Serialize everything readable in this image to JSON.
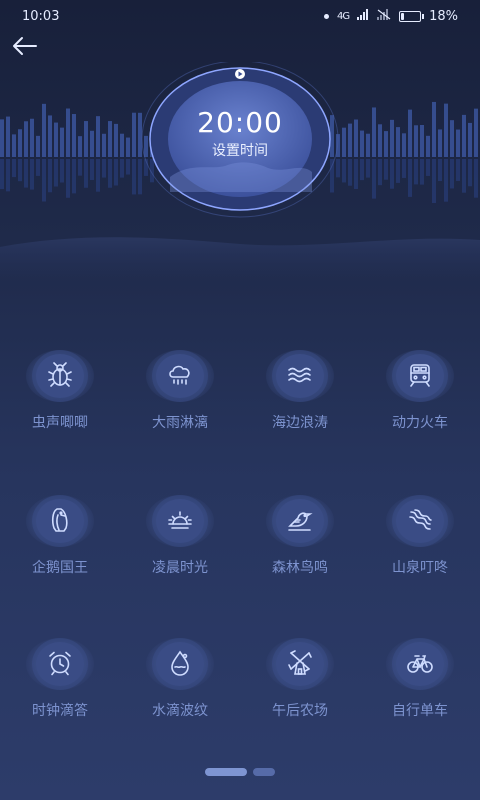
{
  "status": {
    "time": "10:03",
    "network": "4G",
    "battery": "18%",
    "battery_level": 0.18
  },
  "header": {
    "back_icon": "arrow-left-icon"
  },
  "timer": {
    "time": "20:00",
    "label": "设置时间",
    "play_icon": "play-icon"
  },
  "sounds": [
    {
      "label": "虫声唧唧",
      "icon": "beetle-icon"
    },
    {
      "label": "大雨淋漓",
      "icon": "rain-cloud-icon"
    },
    {
      "label": "海边浪涛",
      "icon": "waves-icon"
    },
    {
      "label": "动力火车",
      "icon": "train-icon"
    },
    {
      "label": "企鹅国王",
      "icon": "penguin-icon"
    },
    {
      "label": "凌晨时光",
      "icon": "sunrise-icon"
    },
    {
      "label": "森林鸟鸣",
      "icon": "bird-icon"
    },
    {
      "label": "山泉叮咚",
      "icon": "stream-icon"
    },
    {
      "label": "时钟滴答",
      "icon": "alarm-clock-icon"
    },
    {
      "label": "水滴波纹",
      "icon": "water-drop-icon"
    },
    {
      "label": "午后农场",
      "icon": "windmill-icon"
    },
    {
      "label": "自行单车",
      "icon": "bicycle-icon"
    }
  ],
  "pager": {
    "pages": 2,
    "current": 1
  },
  "colors": {
    "accent": "#7e95d2",
    "icon": "#cfdcff",
    "label": "#7d93cf"
  }
}
